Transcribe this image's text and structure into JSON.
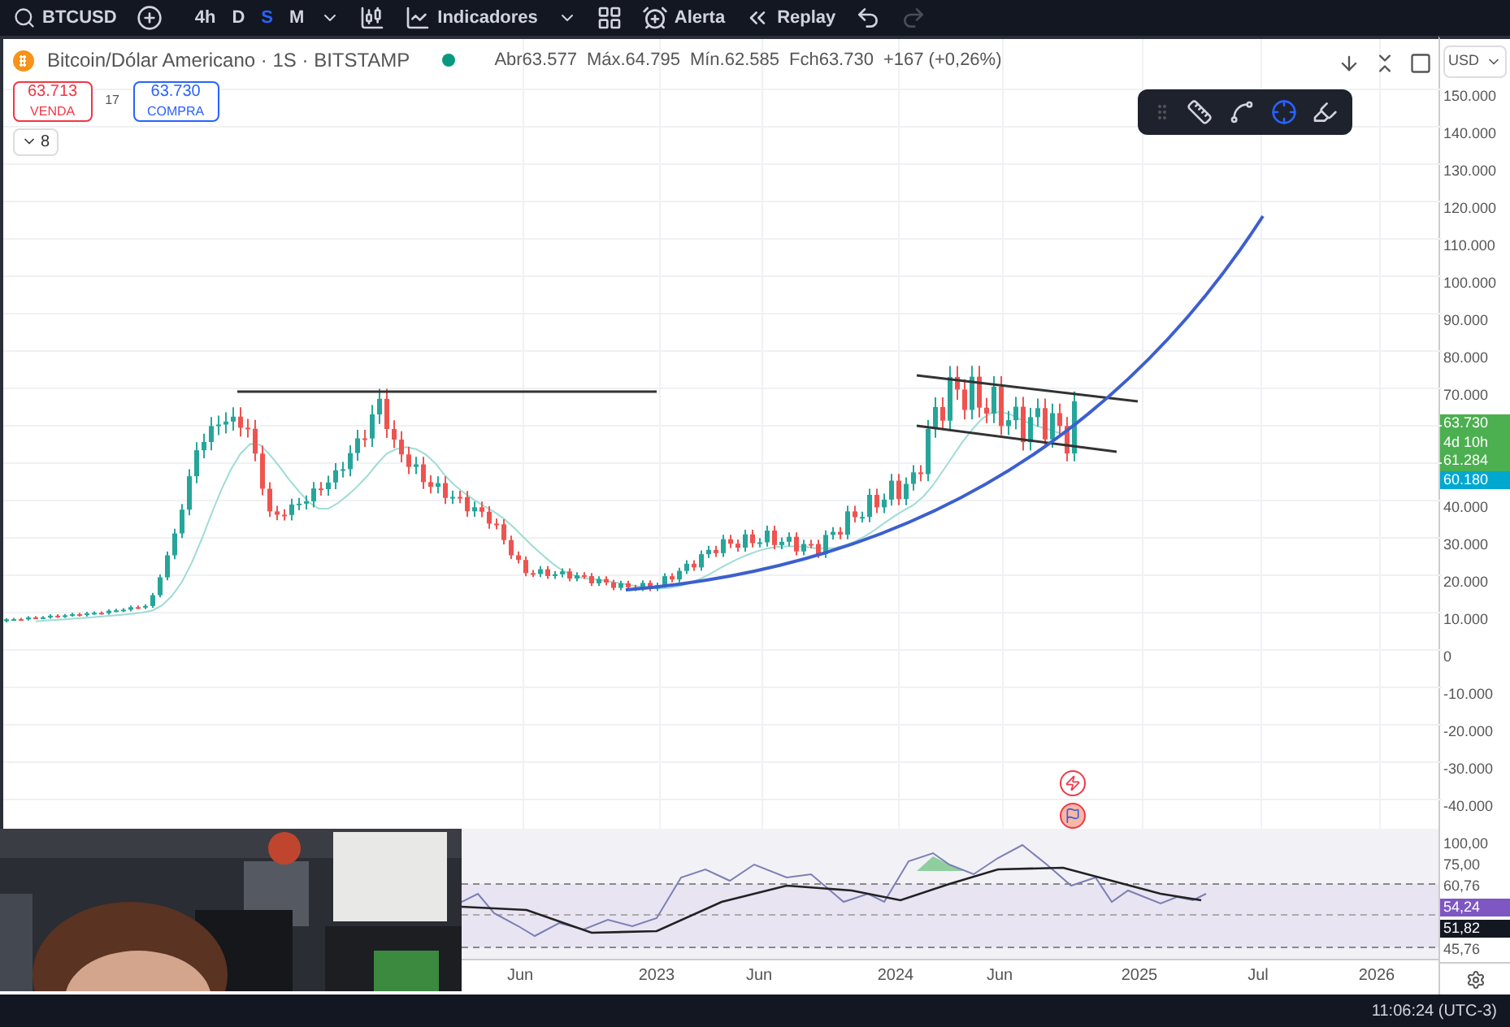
{
  "toolbar": {
    "symbol": "BTCUSD",
    "intervals": [
      {
        "label": "4h",
        "selected": false
      },
      {
        "label": "D",
        "selected": false
      },
      {
        "label": "S",
        "selected": true
      },
      {
        "label": "M",
        "selected": false
      }
    ],
    "indicators_label": "Indicadores",
    "alert_label": "Alerta",
    "replay_label": "Replay",
    "redo_disabled": true
  },
  "legend": {
    "title": "Bitcoin/Dólar Americano · 1S · BITSTAMP",
    "ohlc": [
      "Abr63.577",
      "Máx.64.795",
      "Mín.62.585",
      "Fch63.730",
      "+167 (+0,26%)"
    ],
    "sell": {
      "price": "63.713",
      "label": "VENDA"
    },
    "spread": "17",
    "buy": {
      "price": "63.730",
      "label": "COMPRA"
    },
    "collapsed_count": "8"
  },
  "currency": "USD",
  "price_axis": [
    {
      "kind": "label",
      "text": "150.000"
    },
    {
      "kind": "label",
      "text": "140.000"
    },
    {
      "kind": "label",
      "text": "130.000"
    },
    {
      "kind": "label",
      "text": "120.000"
    },
    {
      "kind": "label",
      "text": "110.000"
    },
    {
      "kind": "label",
      "text": "100.000"
    },
    {
      "kind": "label",
      "text": "90.000"
    },
    {
      "kind": "label",
      "text": "80.000"
    },
    {
      "kind": "label",
      "text": "70.000"
    },
    {
      "kind": "tag",
      "text": "63.730",
      "color": "#4caf50"
    },
    {
      "kind": "tag",
      "text": "4d 10h",
      "color": "#4caf50"
    },
    {
      "kind": "tag",
      "text": "61.284",
      "color": "#4caf50"
    },
    {
      "kind": "tag",
      "text": "60.180",
      "color": "#00a8d0"
    },
    {
      "kind": "label",
      "text": "40.000"
    },
    {
      "kind": "label",
      "text": "30.000"
    },
    {
      "kind": "label",
      "text": "20.000"
    },
    {
      "kind": "label",
      "text": "10.000"
    },
    {
      "kind": "label",
      "text": "0"
    },
    {
      "kind": "label",
      "text": "-10.000"
    },
    {
      "kind": "label",
      "text": "-20.000"
    },
    {
      "kind": "label",
      "text": "-30.000"
    },
    {
      "kind": "label",
      "text": "-40.000"
    }
  ],
  "rsi_axis": [
    {
      "kind": "label",
      "text": "100,00"
    },
    {
      "kind": "label",
      "text": "75,00"
    },
    {
      "kind": "label",
      "text": "60,76"
    },
    {
      "kind": "tag",
      "text": "54,24",
      "color": "#7e57c2"
    },
    {
      "kind": "tag",
      "text": "51,82",
      "color": "#131722"
    },
    {
      "kind": "label",
      "text": "45,76"
    }
  ],
  "time_axis": [
    "Jun",
    "2023",
    "Jun",
    "2024",
    "Jun",
    "2025",
    "Jul",
    "2026"
  ],
  "status": {
    "time": "11:06:24 (UTC-3)"
  }
}
